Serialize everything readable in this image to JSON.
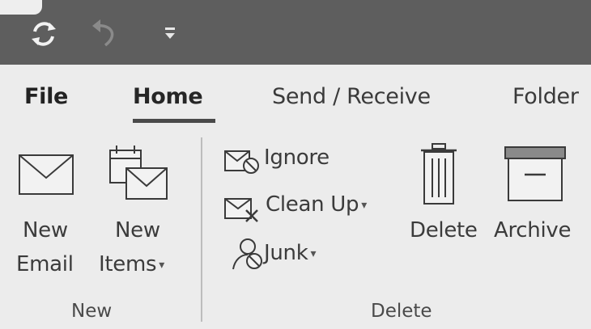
{
  "quick_access": {
    "sync_icon": "sync-icon",
    "undo_icon": "undo-icon",
    "customize_icon": "customize-qa-icon"
  },
  "tabs": [
    {
      "label": "File"
    },
    {
      "label": "Home"
    },
    {
      "label": "Send / Receive"
    },
    {
      "label": "Folder"
    }
  ],
  "ribbon": {
    "new_group": {
      "label": "New",
      "new_email": {
        "line1": "New",
        "line2": "Email"
      },
      "new_items": {
        "line1": "New",
        "line2": "Items"
      }
    },
    "delete_group": {
      "label": "Delete",
      "ignore": "Ignore",
      "clean_up": "Clean Up",
      "junk": "Junk",
      "delete": "Delete",
      "archive": "Archive"
    }
  },
  "colors": {
    "title_bar": "#5e5e5e",
    "ribbon_bg": "#ececec",
    "active_tab_underline": "#4a4a4a"
  }
}
